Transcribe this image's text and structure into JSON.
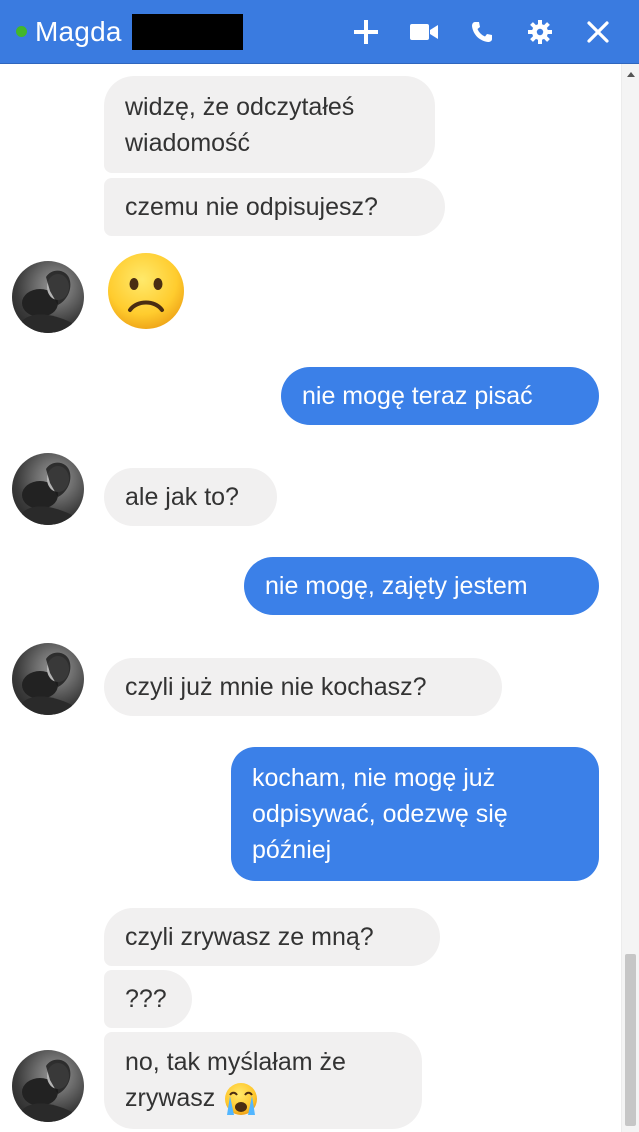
{
  "header": {
    "contact_name": "Magda",
    "presence": "online",
    "actions": [
      "add-person-icon",
      "video-call-icon",
      "voice-call-icon",
      "settings-icon",
      "close-icon"
    ]
  },
  "colors": {
    "header_bg": "#3a7be0",
    "outgoing_bubble": "#3b80e8",
    "incoming_bubble": "#f1f0f0",
    "presence_dot": "#42b72a"
  },
  "messages": [
    {
      "from": "them",
      "text": "widzę, że odczytałeś\nwiadomość"
    },
    {
      "from": "them",
      "text": "czemu nie odpisujesz?"
    },
    {
      "from": "them",
      "emoji": "frowning-face"
    },
    {
      "from": "me",
      "text": "nie mogę teraz pisać"
    },
    {
      "from": "them",
      "text": "ale jak to?"
    },
    {
      "from": "me",
      "text": "nie mogę, zajęty jestem"
    },
    {
      "from": "them",
      "text": "czyli już mnie nie kochasz?"
    },
    {
      "from": "me",
      "text": "kocham, nie mogę już\nodpisywać, odezwę się\npóźniej"
    },
    {
      "from": "them",
      "text": "czyli zrywasz ze mną?"
    },
    {
      "from": "them",
      "text": "???"
    },
    {
      "from": "them",
      "text": "no, tak myślałam że\nzrywasz",
      "emoji": "crying-face"
    }
  ]
}
